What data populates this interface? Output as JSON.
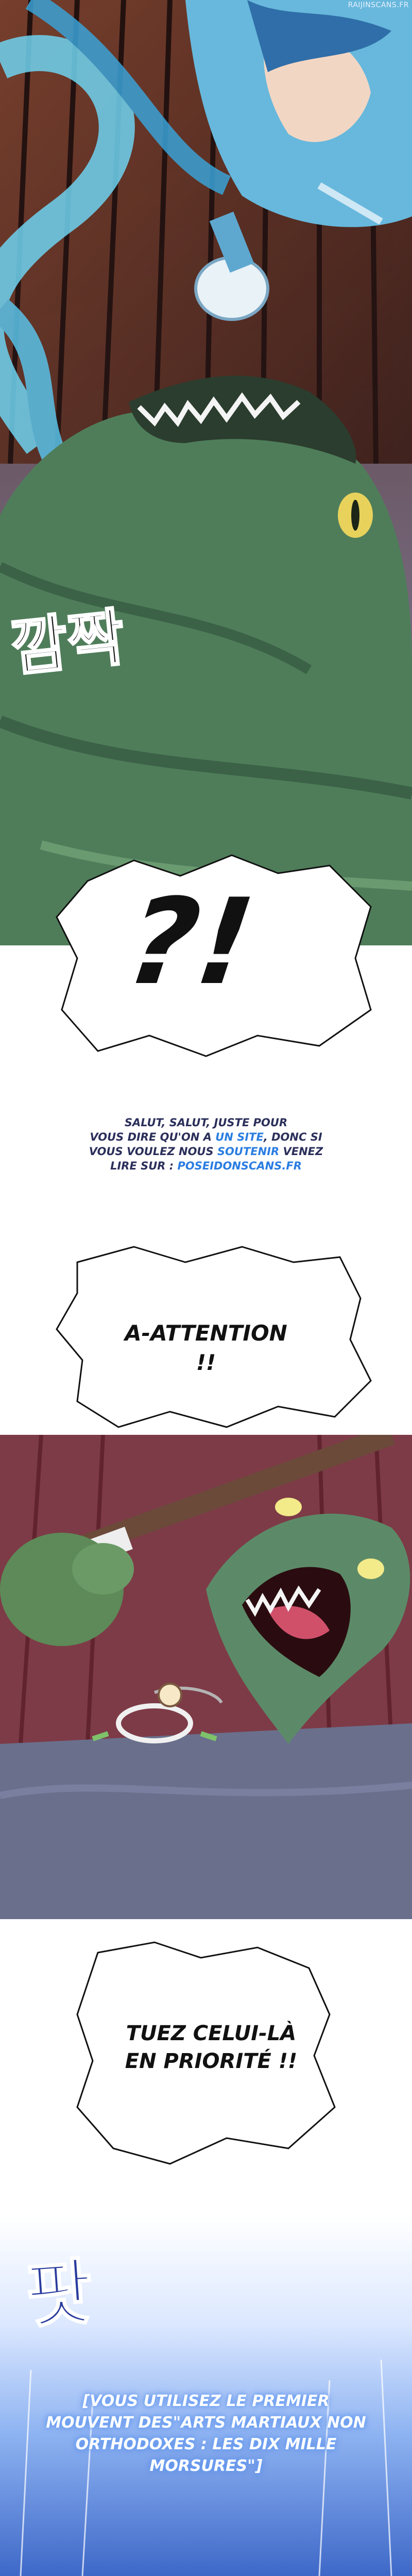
{
  "watermark": "RAIJINSCANS.FR",
  "panel1": {
    "sfx": "깜짝"
  },
  "panel2": {
    "symbol": "?!"
  },
  "promo": {
    "line1": "SALUT, SALUT, JUSTE POUR",
    "line2_pre": "VOUS DIRE QU'ON A ",
    "line2_link": "UN SITE",
    "line2_post": ", DONC SI",
    "line3_pre": "VOUS VOULEZ NOUS ",
    "line3_link": "SOUTENIR",
    "line3_post": " VENEZ",
    "line4_pre": "LIRE SUR : ",
    "line4_link": "POSEIDONSCANS.FR"
  },
  "bubble_attention": "A-ATTENTION !!",
  "bubble_tuez_line1": "TUEZ CELUI-LÀ",
  "bubble_tuez_line2": "EN PRIORITÉ !!",
  "panel4": {
    "sfx": "팟"
  },
  "system_message": {
    "line1": "[VOUS UTILISEZ LE PREMIER",
    "line2": "MOUVENT DES\"ARTS MARTIAUX NON",
    "line3": "ORTHODOXES : LES DIX MILLE",
    "line4": "MORSURES\"]"
  },
  "colors": {
    "link": "#2a7de1",
    "promo_text": "#2b2f5a",
    "monster_green": "#4f7d5a",
    "sky_blue": "#5ab8e6"
  }
}
